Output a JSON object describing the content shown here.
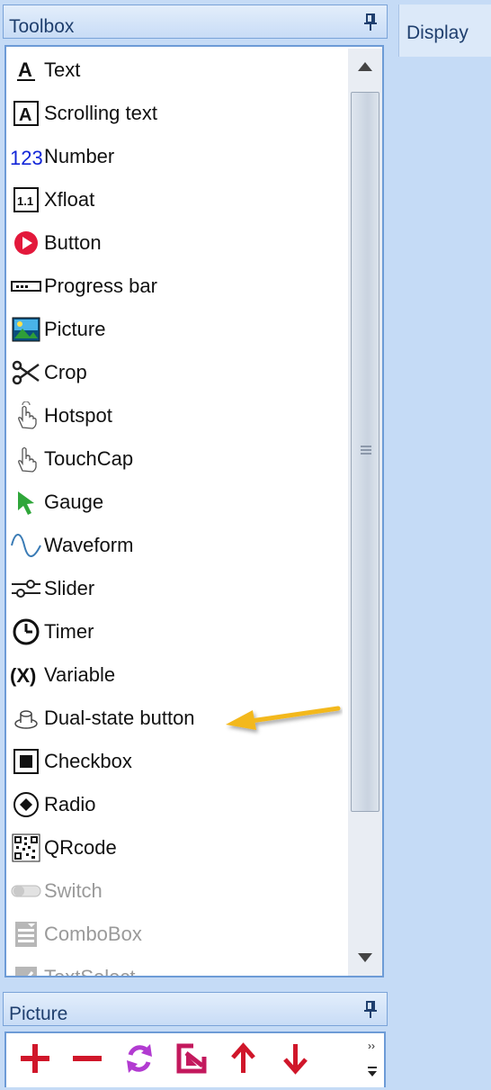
{
  "toolbox": {
    "title": "Toolbox",
    "items": [
      {
        "label": "Text",
        "icon": "text-icon",
        "enabled": true
      },
      {
        "label": "Scrolling text",
        "icon": "scrolling-text-icon",
        "enabled": true
      },
      {
        "label": "Number",
        "icon": "number-icon",
        "enabled": true
      },
      {
        "label": "Xfloat",
        "icon": "xfloat-icon",
        "enabled": true
      },
      {
        "label": "Button",
        "icon": "button-icon",
        "enabled": true
      },
      {
        "label": "Progress bar",
        "icon": "progress-bar-icon",
        "enabled": true
      },
      {
        "label": "Picture",
        "icon": "picture-icon",
        "enabled": true
      },
      {
        "label": "Crop",
        "icon": "scissors-icon",
        "enabled": true
      },
      {
        "label": "Hotspot",
        "icon": "hotspot-hand-icon",
        "enabled": true
      },
      {
        "label": "TouchCap",
        "icon": "touch-hand-icon",
        "enabled": true
      },
      {
        "label": "Gauge",
        "icon": "gauge-pointer-icon",
        "enabled": true
      },
      {
        "label": "Waveform",
        "icon": "waveform-icon",
        "enabled": true
      },
      {
        "label": "Slider",
        "icon": "slider-icon",
        "enabled": true
      },
      {
        "label": "Timer",
        "icon": "clock-icon",
        "enabled": true
      },
      {
        "label": "Variable",
        "icon": "variable-icon",
        "enabled": true
      },
      {
        "label": "Dual-state button",
        "icon": "dual-state-button-icon",
        "enabled": true
      },
      {
        "label": "Checkbox",
        "icon": "checkbox-icon",
        "enabled": true
      },
      {
        "label": "Radio",
        "icon": "radio-icon",
        "enabled": true
      },
      {
        "label": "QRcode",
        "icon": "qrcode-icon",
        "enabled": true
      },
      {
        "label": "Switch",
        "icon": "switch-icon",
        "enabled": false
      },
      {
        "label": "ComboBox",
        "icon": "combobox-icon",
        "enabled": false
      },
      {
        "label": "TextSelect",
        "icon": "textselect-icon",
        "enabled": false
      }
    ]
  },
  "picture_panel": {
    "title": "Picture",
    "toolbar": [
      {
        "icon": "plus-icon"
      },
      {
        "icon": "minus-icon"
      },
      {
        "icon": "refresh-icon"
      },
      {
        "icon": "edit-export-icon"
      },
      {
        "icon": "arrow-up-icon"
      },
      {
        "icon": "arrow-down-icon"
      }
    ]
  },
  "display_tab": {
    "label": "Display"
  },
  "colors": {
    "accent": "#6d9bd6",
    "arrow": "#f3b81f",
    "toolbar_red": "#d0162a",
    "toolbar_purple": "#b23bd1",
    "toolbar_magenta": "#c3195d"
  }
}
